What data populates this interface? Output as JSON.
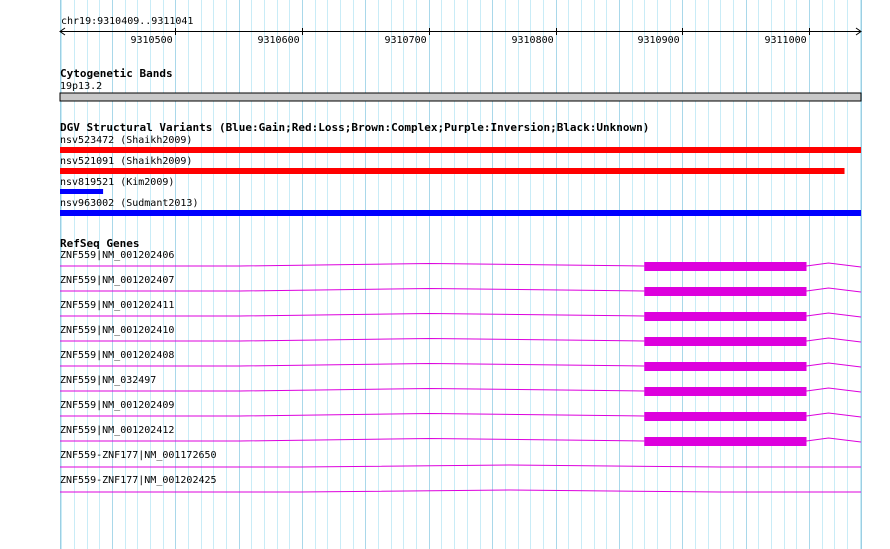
{
  "ruler": {
    "region": "chr19:9310409..9311041",
    "start": 9310409,
    "end": 9311041,
    "ticks": [
      "9310500",
      "9310600",
      "9310700",
      "9310800",
      "9310900",
      "9311000"
    ]
  },
  "cytoband": {
    "title": "Cytogenetic Bands",
    "band": "19p13.2",
    "color": "#c8c8c8"
  },
  "dgv": {
    "title": "DGV Structural Variants (Blue:Gain;Red:Loss;Brown:Complex;Purple:Inversion;Black:Unknown)",
    "variants": [
      {
        "label": "nsv523472 (Shaikh2009)",
        "type": "Loss",
        "color": "#ff0000",
        "start": 9310409,
        "end": 9311041
      },
      {
        "label": "nsv521091 (Shaikh2009)",
        "type": "Loss",
        "color": "#ff0000",
        "start": 9310409,
        "end": 9311028
      },
      {
        "label": "nsv819521 (Kim2009)",
        "type": "Gain",
        "color": "#0000ff",
        "start": 9310409,
        "end": 9310443
      },
      {
        "label": "nsv963002 (Sudmant2013)",
        "type": "Gain",
        "color": "#0000ff",
        "start": 9310409,
        "end": 9311041
      }
    ]
  },
  "refseq": {
    "title": "RefSeq Genes",
    "color": "#dd00dd",
    "genes": [
      {
        "label": "ZNF559|NM_001202406",
        "exon": [
          9310870,
          9310998
        ]
      },
      {
        "label": "ZNF559|NM_001202407",
        "exon": [
          9310870,
          9310998
        ]
      },
      {
        "label": "ZNF559|NM_001202411",
        "exon": [
          9310870,
          9310998
        ]
      },
      {
        "label": "ZNF559|NM_001202410",
        "exon": [
          9310870,
          9310998
        ]
      },
      {
        "label": "ZNF559|NM_001202408",
        "exon": [
          9310870,
          9310998
        ]
      },
      {
        "label": "ZNF559|NM_032497",
        "exon": [
          9310870,
          9310998
        ]
      },
      {
        "label": "ZNF559|NM_001202409",
        "exon": [
          9310870,
          9310998
        ]
      },
      {
        "label": "ZNF559|NM_001202412",
        "exon": [
          9310870,
          9310998
        ]
      },
      {
        "label": "ZNF559-ZNF177|NM_001172650",
        "exon": null
      },
      {
        "label": "ZNF559-ZNF177|NM_001202425",
        "exon": null
      }
    ]
  }
}
